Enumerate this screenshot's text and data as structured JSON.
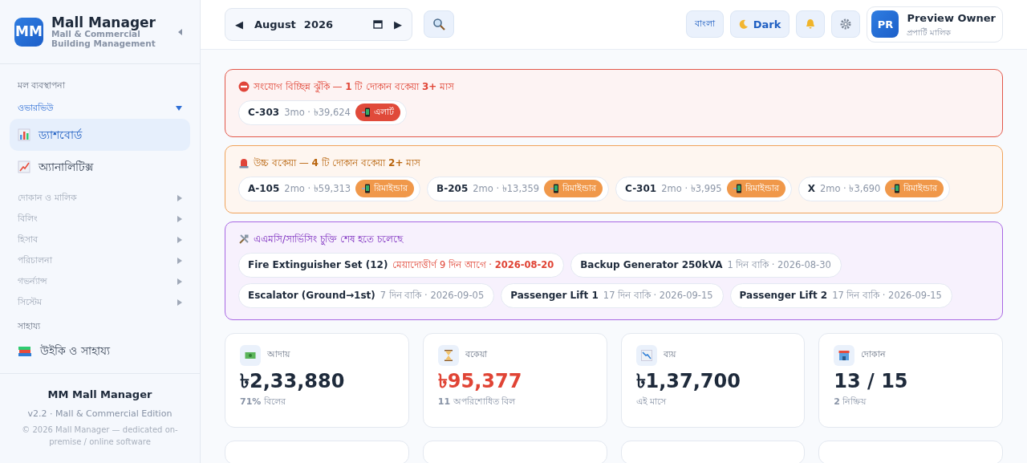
{
  "sidebar": {
    "logo": "MM",
    "title": "Mall Manager",
    "subtitle": "Mall & Commercial Building Management",
    "sections": [
      {
        "heading": "মল ব্যবস্থাপনা",
        "groups": [
          {
            "label": "ওভারভিউ",
            "expanded": true,
            "items": [
              {
                "label": "ড্যাশবোর্ড",
                "selected": true
              },
              {
                "label": "অ্যানালিটিক্স",
                "selected": false
              }
            ]
          },
          {
            "label": "দোকান ও মালিক",
            "expanded": false
          },
          {
            "label": "বিলিং",
            "expanded": false
          },
          {
            "label": "হিসাব",
            "expanded": false
          },
          {
            "label": "পরিচালনা",
            "expanded": false
          },
          {
            "label": "গভর্ন্যান্স",
            "expanded": false
          },
          {
            "label": "সিস্টেম",
            "expanded": false
          }
        ]
      },
      {
        "heading": "সাহায্য",
        "items": [
          {
            "label": "উইকি ও সাহায্য",
            "selected": false
          }
        ]
      }
    ],
    "footer": {
      "title": "MM Mall Manager",
      "version": "v2.2 · Mall & Commercial Edition",
      "copyright": "© 2026 Mall Manager — dedicated on-premise / online software"
    }
  },
  "header": {
    "prev": "◀",
    "month": "August",
    "year": "2026",
    "next": "▶",
    "language": "বাংলা",
    "theme": "Dark",
    "user": {
      "initials": "PR",
      "name": "Preview Owner",
      "role": "প্রপার্টি মালিক"
    }
  },
  "alerts": [
    {
      "kind": "danger",
      "title": "সংযোগ বিচ্ছিন্ন ঝুঁকি — **1** টি দোকান বকেয়া **3+** মাস",
      "items": [
        {
          "code": "C-303",
          "detail": "3mo · ৳39,624",
          "action": "এলার্ট"
        }
      ]
    },
    {
      "kind": "warning",
      "title": "উচ্চ বকেয়া — **4** টি দোকান বকেয়া **2+** মাস",
      "items": [
        {
          "code": "A-105",
          "detail": "2mo · ৳59,313",
          "action": "রিমাইন্ডার"
        },
        {
          "code": "B-205",
          "detail": "2mo · ৳13,359",
          "action": "রিমাইন্ডার"
        },
        {
          "code": "C-301",
          "detail": "2mo · ৳3,995",
          "action": "রিমাইন্ডার"
        },
        {
          "code": "X",
          "detail": "2mo · ৳3,690",
          "action": "রিমাইন্ডার"
        }
      ]
    },
    {
      "kind": "amc",
      "title": "এএমসি/সার্ভিসিং চুক্তি শেষ হতে চলেছে",
      "items": [
        {
          "code": "Fire Extinguisher Set (12)",
          "detail": "মেয়াদোত্তীর্ণ 9 দিন আগে · **2026-08-20**",
          "overdue": true
        },
        {
          "code": "Backup Generator 250kVA",
          "detail": "1 দিন বাকি · 2026-08-30",
          "overdue": false
        },
        {
          "code": "Escalator (Ground→1st)",
          "detail": "7 দিন বাকি · 2026-09-05",
          "overdue": false
        },
        {
          "code": "Passenger Lift 1",
          "detail": "17 দিন বাকি · 2026-09-15",
          "overdue": false
        },
        {
          "code": "Passenger Lift 2",
          "detail": "17 দিন বাকি · 2026-09-15",
          "overdue": false
        }
      ]
    }
  ],
  "stats": [
    {
      "label": "আদায়",
      "value": "৳2,33,880",
      "note": "**71%** বিলের",
      "highlighted": false
    },
    {
      "label": "বকেয়া",
      "value": "৳95,377",
      "note": "**11** অপরিশোধিত বিল",
      "highlighted": true
    },
    {
      "label": "ব্যয়",
      "value": "৳1,37,700",
      "note": "এই মাসে",
      "highlighted": false
    },
    {
      "label": "দোকান",
      "value": "13 / 15",
      "note": "**2** নিষ্ক্রিয়",
      "highlighted": false
    }
  ]
}
